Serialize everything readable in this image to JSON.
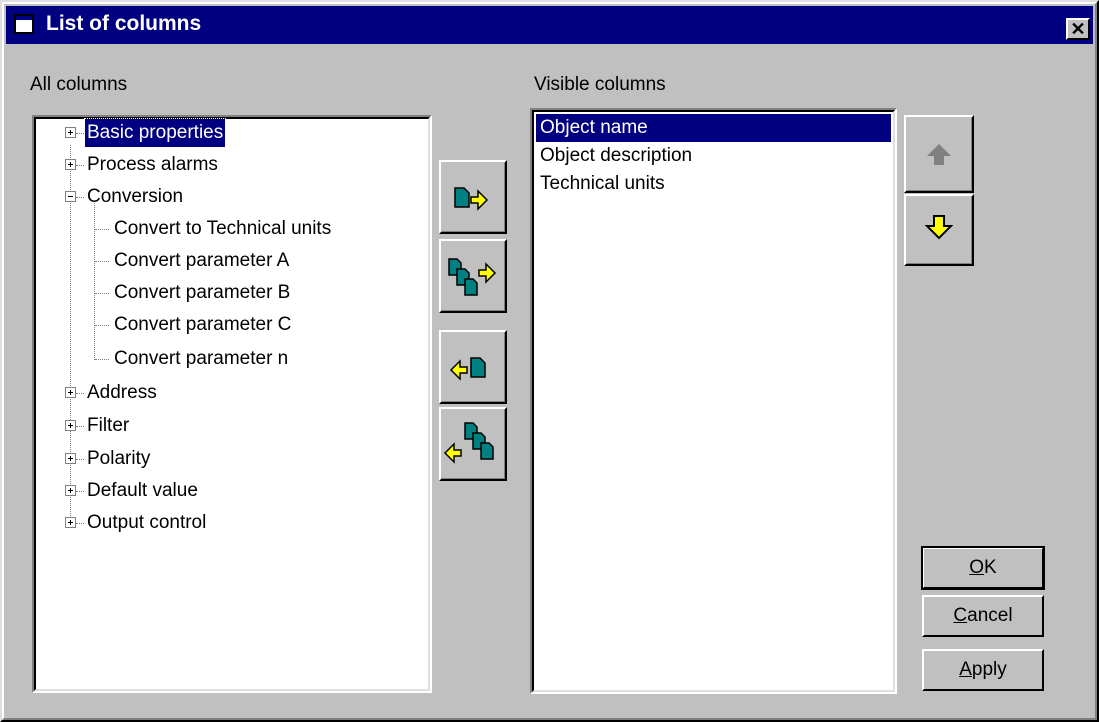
{
  "window": {
    "title": "List of columns",
    "close_glyph": "✕"
  },
  "all_columns": {
    "label": "All columns",
    "tree": [
      {
        "text": "Basic properties",
        "expander": "plus",
        "selected": true
      },
      {
        "text": "Process alarms",
        "expander": "plus"
      },
      {
        "text": "Conversion",
        "expander": "minus"
      },
      {
        "text": "Convert to Technical units",
        "child": true
      },
      {
        "text": "Convert parameter A",
        "child": true
      },
      {
        "text": "Convert parameter B",
        "child": true
      },
      {
        "text": "Convert parameter C",
        "child": true
      },
      {
        "text": "Convert parameter n",
        "child": true
      },
      {
        "text": "Address",
        "expander": "plus"
      },
      {
        "text": "Filter",
        "expander": "plus"
      },
      {
        "text": "Polarity",
        "expander": "plus"
      },
      {
        "text": "Default value",
        "expander": "plus"
      },
      {
        "text": "Output control",
        "expander": "plus"
      }
    ]
  },
  "visible_columns": {
    "label": "Visible columns",
    "items": [
      {
        "text": "Object name",
        "selected": true
      },
      {
        "text": "Object description"
      },
      {
        "text": "Technical units"
      }
    ]
  },
  "transfer_buttons": [
    {
      "icon": "add-column-icon"
    },
    {
      "icon": "add-all-columns-icon"
    },
    {
      "icon": "remove-column-icon"
    },
    {
      "icon": "remove-all-columns-icon"
    }
  ],
  "order_buttons": [
    {
      "icon": "move-up-arrow-icon",
      "enabled": false
    },
    {
      "icon": "move-down-arrow-icon",
      "enabled": true
    }
  ],
  "buttons": {
    "ok": {
      "mnemonic": "O",
      "rest": "K"
    },
    "cancel": {
      "mnemonic": "C",
      "rest": "ancel"
    },
    "apply": {
      "mnemonic": "A",
      "rest": "pply"
    }
  },
  "colors": {
    "title_bar": "#000080",
    "face": "#c0c0c0",
    "selection": "#000080",
    "arrow": "#ffff00",
    "document": "#008080"
  }
}
